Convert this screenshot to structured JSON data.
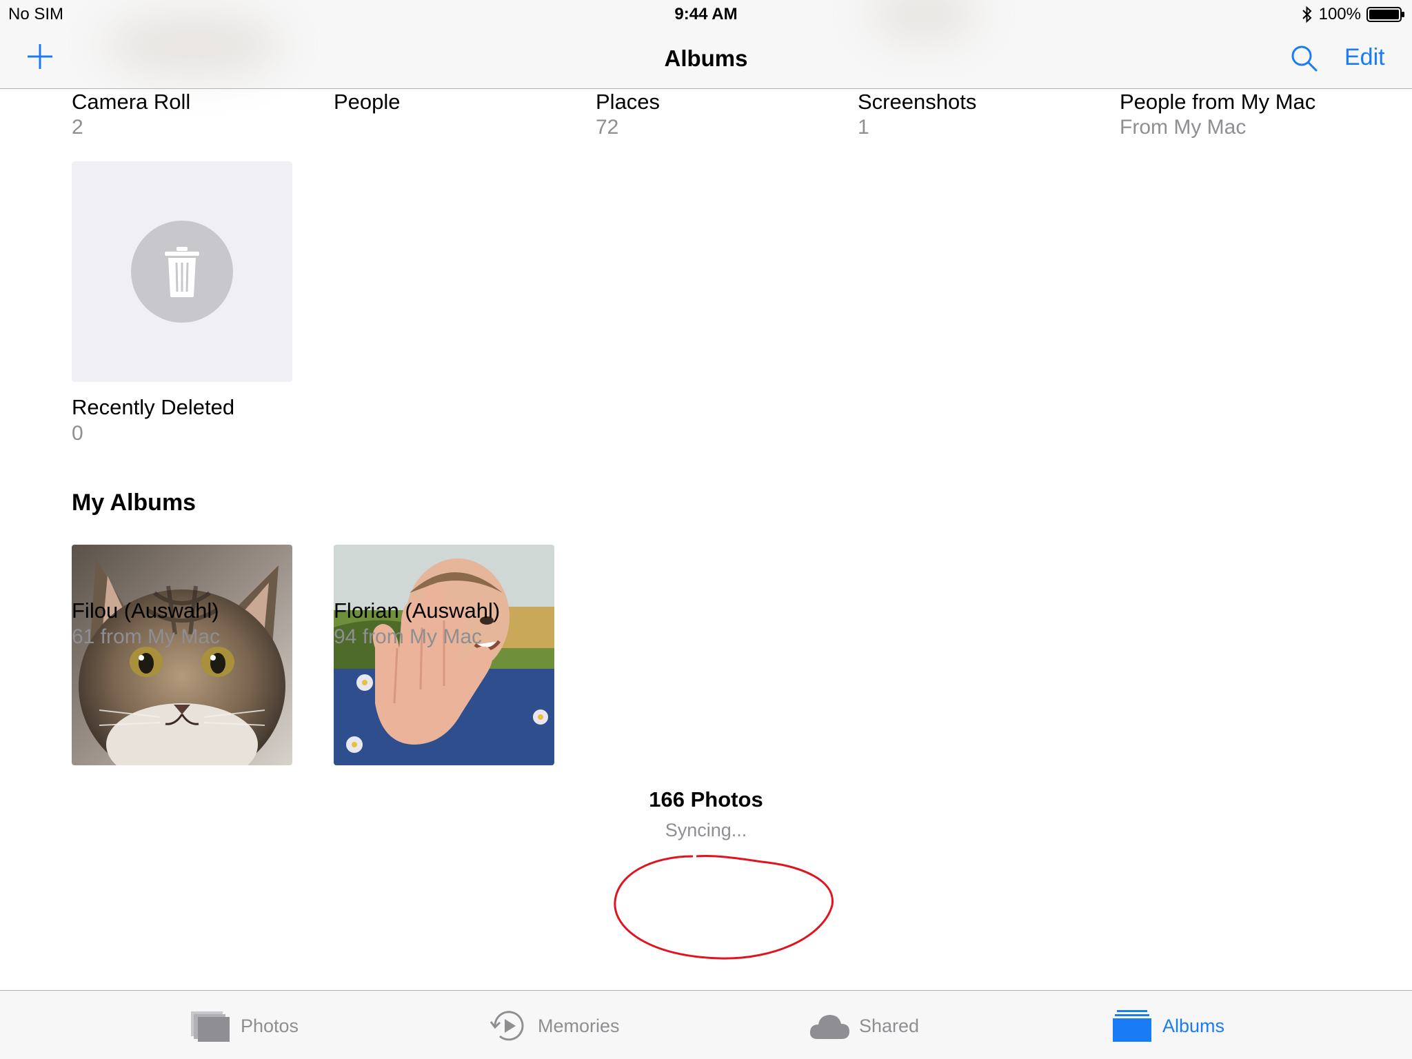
{
  "status_bar": {
    "carrier": "No SIM",
    "time": "9:44 AM",
    "battery": "100%"
  },
  "nav": {
    "title": "Albums",
    "edit_label": "Edit"
  },
  "top_albums": [
    {
      "title": "Camera Roll",
      "subtitle": "2"
    },
    {
      "title": "People",
      "subtitle": ""
    },
    {
      "title": "Places",
      "subtitle": "72"
    },
    {
      "title": "Screenshots",
      "subtitle": "1"
    },
    {
      "title": "People from My Mac",
      "subtitle": "From My Mac"
    }
  ],
  "recently_deleted": {
    "title": "Recently Deleted",
    "subtitle": "0"
  },
  "my_albums": {
    "header": "My Albums",
    "items": [
      {
        "title": "Filou (Auswahl)",
        "subtitle": "61 from My Mac"
      },
      {
        "title": "Florian (Auswahl)",
        "subtitle": "94 from My Mac"
      }
    ]
  },
  "footer": {
    "count": "166 Photos",
    "status": "Syncing..."
  },
  "tabs": [
    {
      "label": "Photos",
      "icon": "photos-icon",
      "selected": false
    },
    {
      "label": "Memories",
      "icon": "memories-icon",
      "selected": false
    },
    {
      "label": "Shared",
      "icon": "cloud-icon",
      "selected": false
    },
    {
      "label": "Albums",
      "icon": "albums-icon",
      "selected": true
    }
  ],
  "colors": {
    "accent": "#1a7cf5",
    "secondary_text": "#8e8e93",
    "annotation": "#e0141e",
    "bar_background": "#f7f7f7"
  }
}
